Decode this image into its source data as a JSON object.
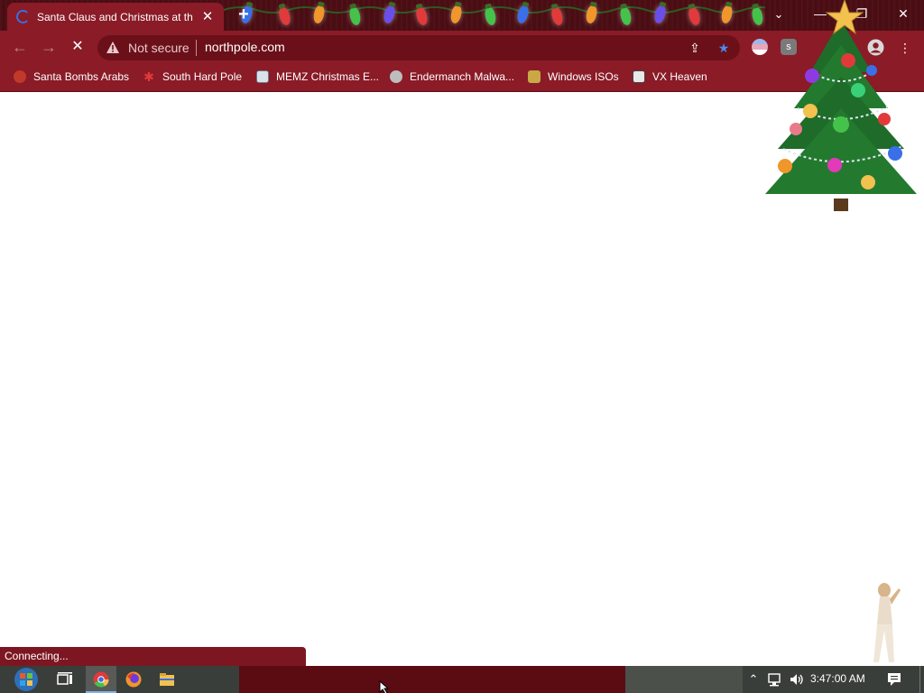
{
  "browser": {
    "tab": {
      "title": "Santa Claus and Christmas at the",
      "close_glyph": "✕"
    },
    "new_tab_glyph": "+",
    "tab_search_glyph": "⌄",
    "window": {
      "minimize": "—",
      "restore": "❐",
      "close": "✕"
    },
    "nav": {
      "back": "←",
      "forward": "→",
      "reload": "✕"
    },
    "omnibox": {
      "security_label": "Not secure",
      "url": "northpole.com"
    },
    "omnibox_actions": {
      "share": "⇪",
      "bookmark": "★"
    },
    "menu_glyph": "⋮",
    "extension_letter": "s"
  },
  "bookmarks": [
    {
      "label": "Santa Bombs Arabs",
      "icon": "santa-icon"
    },
    {
      "label": "South Hard Pole",
      "icon": "snowflake-icon"
    },
    {
      "label": "MEMZ Christmas E...",
      "icon": "memz-icon"
    },
    {
      "label": "Endermanch Malwa...",
      "icon": "raccoon-icon"
    },
    {
      "label": "Windows ISOs",
      "icon": "folder-figure-icon"
    },
    {
      "label": "VX Heaven",
      "icon": "vx-icon"
    }
  ],
  "status_bar": {
    "text": "Connecting..."
  },
  "taskbar": {
    "clock": "3:47:00 AM",
    "apps": [
      "task-view-icon",
      "chrome-icon",
      "firefox-icon",
      "file-explorer-icon"
    ]
  },
  "colors": {
    "chrome_red": "#8a1b27",
    "tabstrip": "#4a0d14",
    "omnibox": "#6b1019"
  }
}
